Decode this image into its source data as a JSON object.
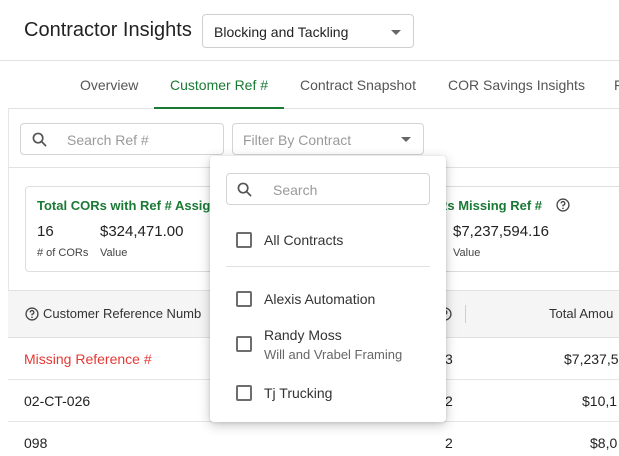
{
  "app": {
    "title": "Contractor Insights",
    "project_select": "Blocking and Tackling"
  },
  "tabs": [
    {
      "label": "Overview"
    },
    {
      "label": "Customer Ref #"
    },
    {
      "label": "Contract Snapshot"
    },
    {
      "label": "COR Savings Insights"
    },
    {
      "label": "F"
    }
  ],
  "active_tab": "Customer Ref #",
  "filters": {
    "search_placeholder": "Search Ref #",
    "contract_placeholder": "Filter By Contract"
  },
  "cards": {
    "left": {
      "title": "Total CORs with Ref # Assig",
      "count": "16",
      "count_caption": "# of CORs",
      "amount": "$324,471.00",
      "amount_caption": "Value"
    },
    "right": {
      "title": "Rs Missing Ref #",
      "amount": "$7,237,594.16",
      "amount_caption": "Value"
    }
  },
  "table": {
    "columns": {
      "ref": "Customer Reference Numb",
      "total": "Total Amou"
    },
    "rows": [
      {
        "ref": "Missing Reference #",
        "count": "3",
        "total": "$7,237,5",
        "missing": true
      },
      {
        "ref": "02-CT-026",
        "count": "2",
        "total": "$10,1"
      },
      {
        "ref": "098",
        "count": "2",
        "total": "$8,0"
      }
    ]
  },
  "dropdown": {
    "search_placeholder": "Search",
    "all_label": "All Contracts",
    "options": [
      {
        "label": "Alexis Automation",
        "sub": ""
      },
      {
        "label": "Randy Moss",
        "sub": "Will and Vrabel Framing"
      },
      {
        "label": "Tj Trucking",
        "sub": ""
      }
    ]
  },
  "colors": {
    "accent": "#1a7a35",
    "missing": "#e53935",
    "header_bg": "#f5f5f5"
  },
  "icons": {
    "search": "search-icon",
    "help": "help-circle-icon",
    "caret": "chevron-down-icon",
    "checkbox": "checkbox-unchecked-icon"
  }
}
